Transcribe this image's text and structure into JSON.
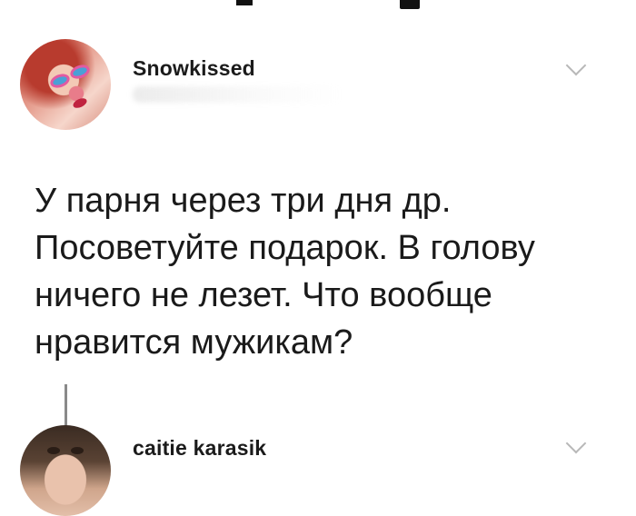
{
  "post": {
    "username": "Snowkissed",
    "text_lines": [
      "У парня через три дня др.",
      "Посоветуйте подарок. В голову",
      "ничего не лезет. Что вообще",
      "нравится мужикам?"
    ]
  },
  "reply": {
    "username": "caitie karasik"
  },
  "icons": {
    "post_menu": "chevron-down-icon",
    "reply_menu": "chevron-down-icon"
  },
  "colors": {
    "background": "#ffffff",
    "text": "#1a1a1a",
    "thread_line": "#8a8a8a",
    "chevron": "#b8b8b8"
  }
}
